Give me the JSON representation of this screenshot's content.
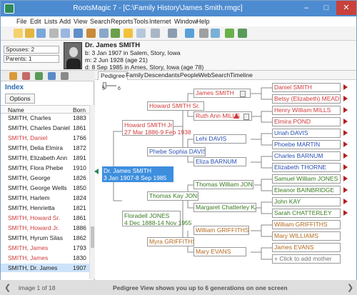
{
  "window": {
    "title": "RootsMagic 7 - [C:\\Family History\\James Smith.rmgc]",
    "minimize": "–",
    "maximize": "□",
    "close": "✕"
  },
  "menu": [
    "File",
    "Edit",
    "Lists",
    "Add",
    "View",
    "Search",
    "Reports",
    "Tools",
    "Internet",
    "Window",
    "Help"
  ],
  "header": {
    "spouses": "Spouses: 2",
    "parents": "Parents: 1",
    "name": "Dr. James SMITH",
    "birth": "b: 3 Jan 1907 in Salem, Story, Iowa",
    "marriage": "m: 2 Jun 1928 (age 21)",
    "death": "d: 8 Sep 1985 in Ames, Story, Iowa (age 78)"
  },
  "index": {
    "title": "Index",
    "options": "Options",
    "col_name": "Name",
    "col_born": "Born",
    "rows": [
      {
        "name": "SMITH, Charles",
        "born": "1883",
        "color": "black"
      },
      {
        "name": "SMITH, Charles Daniel",
        "born": "1861",
        "color": "black"
      },
      {
        "name": "SMITH, Daniel",
        "born": "1766",
        "color": "red"
      },
      {
        "name": "SMITH, Delia Elmira",
        "born": "1872",
        "color": "black"
      },
      {
        "name": "SMITH, Elizabeth Ann",
        "born": "1891",
        "color": "black"
      },
      {
        "name": "SMITH, Flora Phebe",
        "born": "1910",
        "color": "black"
      },
      {
        "name": "SMITH, George",
        "born": "1826",
        "color": "black"
      },
      {
        "name": "SMITH, George Wells",
        "born": "1850",
        "color": "black"
      },
      {
        "name": "SMITH, Harlem",
        "born": "1824",
        "color": "black"
      },
      {
        "name": "SMITH, Henrietta",
        "born": "1821",
        "color": "black"
      },
      {
        "name": "SMITH, Howard Sr.",
        "born": "1861",
        "color": "red"
      },
      {
        "name": "SMITH, Howard Jr.",
        "born": "1886",
        "color": "red"
      },
      {
        "name": "SMITH, Hyrum Silas",
        "born": "1862",
        "color": "black"
      },
      {
        "name": "SMITH, James",
        "born": "1793",
        "color": "red"
      },
      {
        "name": "SMITH, James",
        "born": "1830",
        "color": "red"
      },
      {
        "name": "SMITH, Dr. James",
        "born": "1907",
        "color": "black"
      }
    ]
  },
  "tabs": [
    "Pedigree",
    "Family",
    "Descendants",
    "People",
    "WebSearch",
    "Timeline"
  ],
  "slider_labels": {
    "min": "5",
    "max": "6"
  },
  "pedigree": {
    "focus_name": "Dr. James SMITH",
    "focus_dates": "3 Jan 1907-8 Sep 1985",
    "father_name": "Howard SMITH Jr.",
    "father_dates": "27 Mar 1886-9 Feb 1938",
    "mother_name": "Floradell JONES",
    "mother_dates": "4 Dec 1888-14 Nov 1955",
    "gen3": [
      "Howard SMITH Sr.",
      "Phebe Sophia DAVIS",
      "Thomas Kay JONES",
      "Myra GRIFFITHS"
    ],
    "gen4": [
      "James SMITH",
      "Ruth Ann MILLS",
      "Lehi DAVIS",
      "Eliza BARNUM",
      "Thomas William JONES",
      "Margaret Chatterley KAY",
      "William GRIFFITHS",
      "Mary EVANS"
    ],
    "gen5": [
      "Daniel SMITH",
      "Betsy (Elizabeth) MEAD",
      "Henry William MILLS",
      "Elmira POND",
      "Uriah DAVIS",
      "Phoebe MARTIN",
      "Charles BARNUM",
      "Elizabeth THORNE",
      "Samuel William JONES",
      "Eleanor BAINBRIDGE",
      "John KAY",
      "Sarah CHATTERLEY",
      "William GRIFFITHS",
      "Mary WILLIAMS",
      "James EVANS",
      "+ Click to add mother"
    ]
  },
  "status": {
    "image": "image 1 of 18",
    "caption": "Pedigree View shows you up to 6 generations on one screen"
  },
  "colors": {
    "title_bar": "#4d8bd0",
    "focus": "#3d8fde",
    "male": "#2a51b3",
    "female": "#d13b3b",
    "arrow": "#b52020"
  }
}
